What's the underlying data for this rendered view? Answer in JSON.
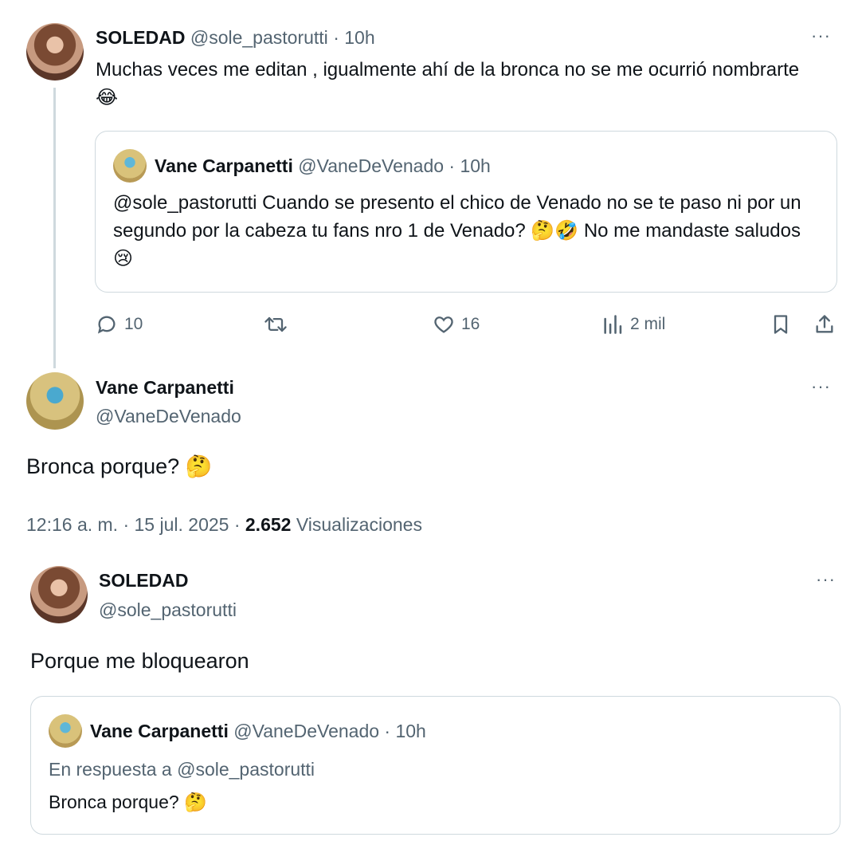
{
  "tweet1": {
    "name": "SOLEDAD",
    "handle": "@sole_pastorutti",
    "time": "· 10h",
    "text": "Muchas veces me editan , igualmente ahí de la bronca no se me ocurrió nombrarte 😂",
    "quote": {
      "name": "Vane Carpanetti",
      "handle": "@VaneDeVenado",
      "time": "· 10h",
      "text": "@sole_pastorutti  Cuando se presento el chico de Venado no se te paso ni por un segundo por la cabeza tu fans nro 1 de Venado? 🤔🤣 No me mandaste saludos 😢"
    },
    "actions": {
      "replies": "10",
      "likes": "16",
      "views": "2 mil"
    }
  },
  "tweet2": {
    "name": "Vane Carpanetti",
    "handle": "@VaneDeVenado",
    "text": "Bronca porque? 🤔",
    "meta_time": "12:16 a. m. · 15 jul. 2025 ·",
    "views_count": "2.652",
    "views_label": "Visualizaciones"
  },
  "tweet3": {
    "name": "SOLEDAD",
    "handle": "@sole_pastorutti",
    "text": "Porque me bloquearon",
    "quote": {
      "name": "Vane Carpanetti",
      "handle": "@VaneDeVenado",
      "time": "· 10h",
      "reply_to": "En respuesta a @sole_pastorutti",
      "text": "Bronca porque? 🤔"
    }
  },
  "icons": {
    "more": "more-dots-icon",
    "reply": "reply-icon",
    "retweet": "retweet-icon",
    "like": "heart-icon",
    "views": "views-icon",
    "bookmark": "bookmark-icon",
    "share": "share-icon"
  },
  "colors": {
    "text": "#0f1419",
    "muted": "#536471",
    "border": "#cfd9de"
  }
}
